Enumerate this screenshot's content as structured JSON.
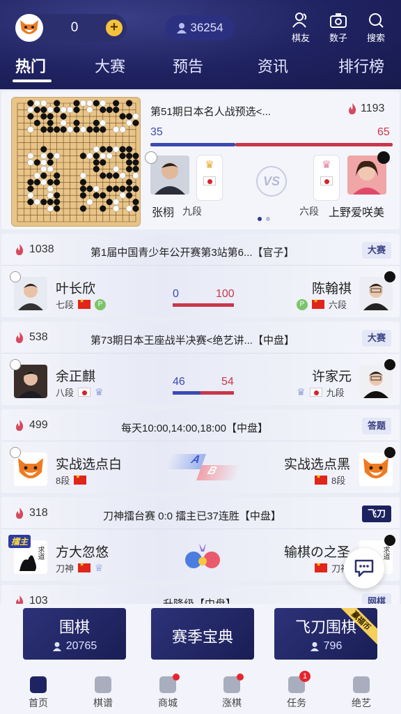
{
  "header": {
    "coins": "0",
    "online_count": "36254",
    "icons": [
      {
        "label": "棋友",
        "icon": "friends-icon"
      },
      {
        "label": "数子",
        "icon": "camera-icon"
      },
      {
        "label": "搜索",
        "icon": "search-icon"
      }
    ],
    "tabs": [
      "热门",
      "大赛",
      "预告",
      "资讯",
      "排行榜"
    ],
    "active_tab": "热门"
  },
  "featured": {
    "title": "第51期日本名人战预选<...",
    "heat": "1193",
    "score_left": "35",
    "score_right": "65",
    "left_player": {
      "name": "张栩",
      "rank": "九段",
      "stone": "white"
    },
    "right_player": {
      "name": "上野爱咲美",
      "rank": "六段",
      "stone": "black"
    },
    "vs": "VS",
    "pager": {
      "current": 1,
      "total": 2
    }
  },
  "matches": [
    {
      "heat": "1038",
      "title": "第1届中国青少年公开赛第3站第6...【官子】",
      "tag": "大赛",
      "left": {
        "name": "叶长欣",
        "rank": "七段"
      },
      "right": {
        "name": "陈翰祺",
        "rank": "六段"
      },
      "score_left": "0",
      "score_right": "100"
    },
    {
      "heat": "538",
      "title": "第73期日本王座战半决赛<绝艺讲...【中盘】",
      "tag": "大赛",
      "left": {
        "name": "余正麒",
        "rank": "八段"
      },
      "right": {
        "name": "许家元",
        "rank": "九段"
      },
      "score_left": "46",
      "score_right": "54"
    },
    {
      "heat": "499",
      "title": "每天10:00,14:00,18:00【中盘】",
      "tag": "答题",
      "left": {
        "name": "实战选点白",
        "rank": "8段"
      },
      "right": {
        "name": "实战选点黑",
        "rank": "8段"
      },
      "ab": [
        "A",
        "B"
      ]
    },
    {
      "heat": "318",
      "title": "刀神擂台赛 0:0 擂主已37连胜【中盘】",
      "tag": "飞刀",
      "left": {
        "name": "方大忽悠",
        "rank": "刀神",
        "badge": "擂主",
        "avatar_text": "求道"
      },
      "right": {
        "name": "输棋の之圣",
        "rank": "刀神",
        "avatar_text": "求道"
      }
    },
    {
      "heat": "103",
      "title": "升降级【中盘】",
      "tag": "网棋"
    }
  ],
  "bottom_buttons": [
    {
      "title": "围棋",
      "count": "20765"
    },
    {
      "title": "赛季宝典",
      "count": ""
    },
    {
      "title": "飞刀围棋",
      "count": "796",
      "ribbon": "赢福币"
    }
  ],
  "nav": [
    {
      "label": "首页",
      "icon": "home-icon",
      "active": true
    },
    {
      "label": "棋谱",
      "icon": "record-icon"
    },
    {
      "label": "商城",
      "icon": "shop-icon",
      "dot": true
    },
    {
      "label": "涨棋",
      "icon": "improve-icon",
      "dot": true
    },
    {
      "label": "任务",
      "icon": "task-icon",
      "badge": "1"
    },
    {
      "label": "绝艺",
      "icon": "jueyi-icon"
    }
  ],
  "colors": {
    "header": "#1f2260",
    "blue": "#3b4ab0",
    "red": "#c8374a"
  }
}
